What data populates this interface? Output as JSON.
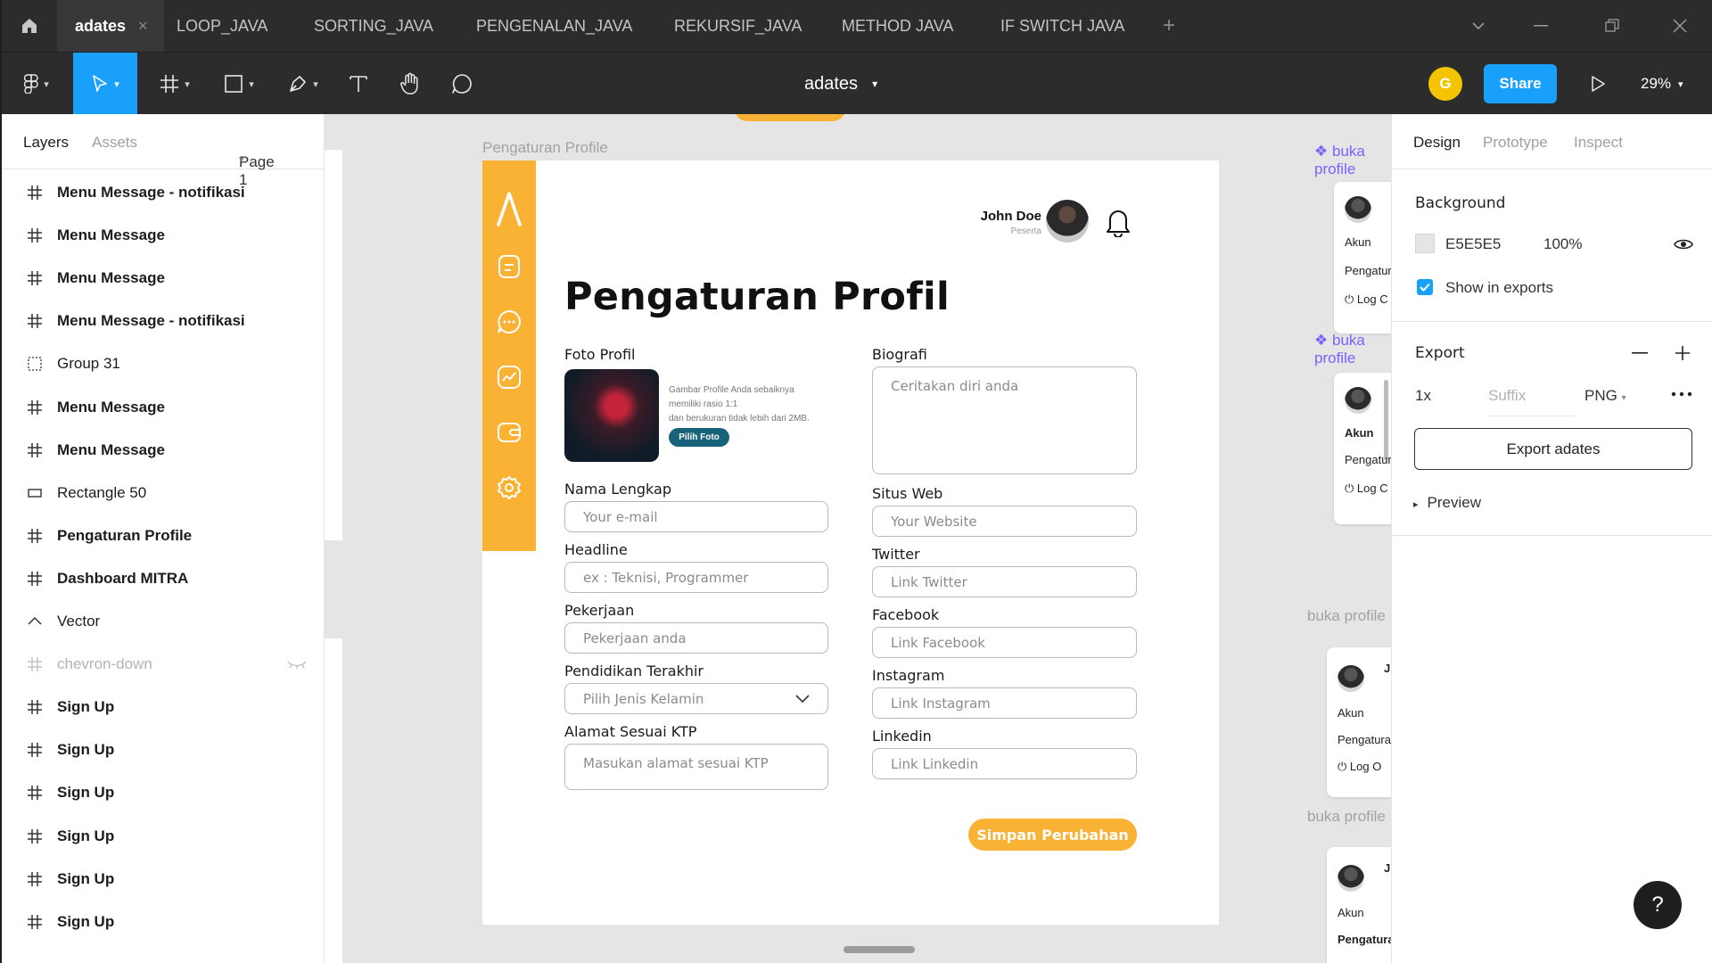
{
  "tabs": {
    "items": [
      {
        "label": "adates",
        "active": true
      },
      {
        "label": "LOOP_JAVA"
      },
      {
        "label": "SORTING_JAVA"
      },
      {
        "label": "PENGENALAN_JAVA"
      },
      {
        "label": "REKURSIF_JAVA"
      },
      {
        "label": "METHOD JAVA"
      },
      {
        "label": "IF SWITCH JAVA"
      }
    ],
    "close_glyph": "×",
    "add_glyph": "+"
  },
  "toolbar": {
    "doc_title": "adates",
    "avatar_initial": "G",
    "share_label": "Share",
    "zoom": "29%"
  },
  "layers": {
    "tab_layers": "Layers",
    "tab_assets": "Assets",
    "page": "Page 1",
    "items": [
      {
        "label": "Menu Message - notifikasi",
        "icon": "frame-icon",
        "bold": true
      },
      {
        "label": "Menu Message",
        "icon": "frame-icon",
        "bold": true
      },
      {
        "label": "Menu Message",
        "icon": "frame-icon",
        "bold": true
      },
      {
        "label": "Menu Message - notifikasi",
        "icon": "frame-icon",
        "bold": true
      },
      {
        "label": "Group 31",
        "icon": "group-icon",
        "bold": false
      },
      {
        "label": "Menu Message",
        "icon": "frame-icon",
        "bold": true
      },
      {
        "label": "Menu Message",
        "icon": "frame-icon",
        "bold": true
      },
      {
        "label": "Rectangle 50",
        "icon": "rectangle-icon",
        "bold": false
      },
      {
        "label": "Pengaturan Profile",
        "icon": "frame-icon",
        "bold": true
      },
      {
        "label": "Dashboard MITRA",
        "icon": "frame-icon",
        "bold": true
      },
      {
        "label": "Vector",
        "icon": "vector-icon",
        "bold": false
      },
      {
        "label": "chevron-down",
        "icon": "frame-icon",
        "bold": false,
        "hidden": true
      },
      {
        "label": "Sign Up",
        "icon": "frame-icon",
        "bold": true
      },
      {
        "label": "Sign Up",
        "icon": "frame-icon",
        "bold": true
      },
      {
        "label": "Sign Up",
        "icon": "frame-icon",
        "bold": true
      },
      {
        "label": "Sign Up",
        "icon": "frame-icon",
        "bold": true
      },
      {
        "label": "Sign Up",
        "icon": "frame-icon",
        "bold": true
      },
      {
        "label": "Sign Up",
        "icon": "frame-icon",
        "bold": true
      }
    ]
  },
  "canvas": {
    "frame_label": "Pengaturan Profile",
    "side_labels": [
      "buka profile",
      "buka profile",
      "buka profile",
      "buka profile"
    ],
    "mini_texts": {
      "akun": "Akun",
      "pengaturan": "Pengatura",
      "logout": "Log O",
      "logout_short": "Log C",
      "j": "J",
      "jo": "Jo"
    }
  },
  "profile": {
    "user_name": "John Doe",
    "user_role": "Peserta",
    "title": "Pengaturan Profil",
    "photo_label": "Foto Profil",
    "photo_note_1": "Gambar Profile Anda sebaiknya",
    "photo_note_2": "memiliki rasio 1:1",
    "photo_note_3": "dan berukuran tidak lebih dari 2MB.",
    "pick_photo": "Pilih Foto",
    "left_fields": [
      {
        "label": "Nama Lengkap",
        "placeholder": "Your e-mail"
      },
      {
        "label": "Headline",
        "placeholder": "ex : Teknisi, Programmer"
      },
      {
        "label": "Pekerjaan",
        "placeholder": "Pekerjaan anda"
      },
      {
        "label": "Pendidikan Terakhir",
        "placeholder": "Pilih Jenis Kelamin"
      },
      {
        "label": "Alamat Sesuai KTP",
        "placeholder": "Masukan alamat sesuai KTP"
      }
    ],
    "bio_label": "Biografi",
    "bio_placeholder": "Ceritakan diri anda",
    "right_fields": [
      {
        "label": "Situs Web",
        "placeholder": "Your Website"
      },
      {
        "label": "Twitter",
        "placeholder": "Link Twitter"
      },
      {
        "label": "Facebook",
        "placeholder": "Link Facebook"
      },
      {
        "label": "Instagram",
        "placeholder": "Link Instagram"
      },
      {
        "label": "Linkedin",
        "placeholder": "Link Linkedin"
      }
    ],
    "save_label": "Simpan Perubahan"
  },
  "design_panel": {
    "tab_design": "Design",
    "tab_prototype": "Prototype",
    "tab_inspect": "Inspect",
    "background_title": "Background",
    "bg_hex": "E5E5E5",
    "bg_opacity": "100%",
    "show_in_exports": "Show in exports",
    "export_title": "Export",
    "scale": "1x",
    "suffix_placeholder": "Suffix",
    "format": "PNG",
    "export_button": "Export adates",
    "preview": "Preview",
    "help": "?"
  },
  "colors": {
    "accent": "#18a0fb",
    "brand_orange": "#f9b233",
    "dark_teal": "#17647a",
    "chrome": "#2c2c2c"
  }
}
